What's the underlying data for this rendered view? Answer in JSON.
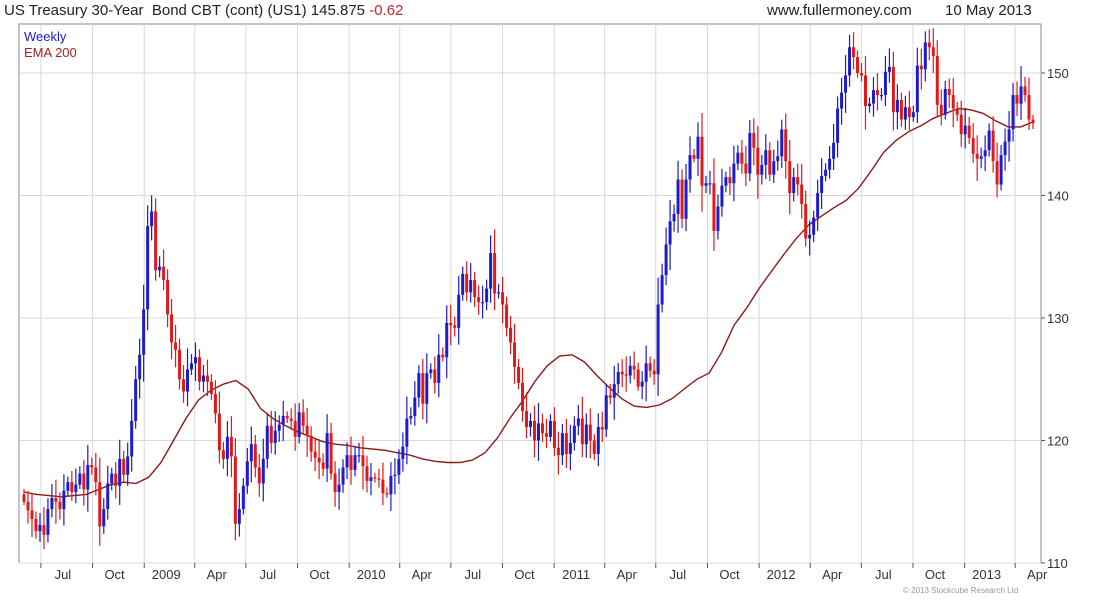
{
  "header": {
    "instrument": "US Treasury 30-Year  Bond CBT (cont) (US1)",
    "last": "145.875",
    "change": "-0.62",
    "site": "www.fullermoney.com",
    "date": "10 May 2013"
  },
  "legend": {
    "period": "Weekly",
    "overlay": "EMA 200"
  },
  "copyright": "© 2013 Stockcube Research Ltd",
  "colors": {
    "up": "#1c1cc8",
    "down": "#e01a1a",
    "ema": "#8b1a1a",
    "grid": "#d9d9d9",
    "axis": "#555555"
  },
  "chart_data": {
    "type": "candlestick",
    "period": "weekly",
    "ylim": [
      110,
      154
    ],
    "yticks": [
      110,
      120,
      130,
      140,
      150
    ],
    "xlim": [
      "2008-05-23",
      "2013-05-17"
    ],
    "xticks": [
      {
        "date": "2008-07-01",
        "label": "Jul"
      },
      {
        "date": "2008-10-01",
        "label": "Oct"
      },
      {
        "date": "2009-01-01",
        "label": "2009"
      },
      {
        "date": "2009-04-01",
        "label": "Apr"
      },
      {
        "date": "2009-07-01",
        "label": "Jul"
      },
      {
        "date": "2009-10-01",
        "label": "Oct"
      },
      {
        "date": "2010-01-01",
        "label": "2010"
      },
      {
        "date": "2010-04-01",
        "label": "Apr"
      },
      {
        "date": "2010-07-01",
        "label": "Jul"
      },
      {
        "date": "2010-10-01",
        "label": "Oct"
      },
      {
        "date": "2011-01-01",
        "label": "2011"
      },
      {
        "date": "2011-04-01",
        "label": "Apr"
      },
      {
        "date": "2011-07-01",
        "label": "Jul"
      },
      {
        "date": "2011-10-01",
        "label": "Oct"
      },
      {
        "date": "2012-01-01",
        "label": "2012"
      },
      {
        "date": "2012-04-01",
        "label": "Apr"
      },
      {
        "date": "2012-07-01",
        "label": "Jul"
      },
      {
        "date": "2012-10-01",
        "label": "Oct"
      },
      {
        "date": "2013-01-01",
        "label": "2013"
      },
      {
        "date": "2013-04-01",
        "label": "Apr"
      }
    ],
    "close": [
      115.0,
      114.3,
      113.6,
      112.6,
      113.1,
      112.3,
      114.4,
      115.3,
      115.0,
      114.4,
      115.9,
      116.6,
      115.8,
      116.4,
      117.3,
      116.0,
      118.0,
      117.8,
      116.6,
      113.0,
      114.4,
      116.5,
      117.3,
      116.3,
      118.5,
      117.2,
      118.7,
      121.6,
      125.0,
      127.0,
      130.7,
      137.5,
      138.7,
      133.9,
      134.2,
      133.1,
      130.3,
      128.0,
      127.4,
      125.0,
      124.0,
      125.8,
      126.3,
      126.8,
      124.8,
      125.3,
      124.8,
      123.8,
      122.2,
      119.2,
      118.5,
      120.3,
      118.7,
      113.2,
      114.4,
      116.3,
      118.3,
      119.7,
      117.8,
      116.5,
      118.5,
      121.2,
      119.8,
      120.8,
      121.3,
      122.0,
      121.8,
      121.6,
      120.3,
      122.3,
      121.2,
      120.4,
      119.1,
      118.6,
      118.2,
      117.7,
      120.6,
      117.3,
      115.8,
      116.4,
      117.8,
      118.8,
      117.6,
      118.8,
      118.8,
      117.9,
      116.7,
      117.0,
      116.9,
      116.8,
      115.7,
      115.6,
      117.1,
      117.2,
      118.5,
      119.5,
      121.8,
      122.0,
      123.5,
      125.5,
      123.0,
      125.5,
      125.8,
      124.7,
      127.0,
      126.8,
      129.6,
      129.4,
      129.2,
      131.9,
      133.6,
      132.1,
      133.1,
      131.7,
      131.3,
      131.3,
      132.4,
      135.3,
      132.0,
      132.1,
      131.1,
      129.2,
      128.0,
      126.0,
      124.7,
      122.4,
      121.1,
      121.6,
      120.0,
      121.4,
      120.6,
      120.3,
      121.6,
      119.4,
      118.8,
      120.6,
      118.9,
      119.8,
      121.2,
      121.8,
      119.7,
      121.3,
      120.0,
      118.9,
      121.1,
      120.9,
      123.7,
      123.5,
      124.6,
      125.6,
      125.4,
      125.3,
      126.1,
      125.8,
      124.4,
      124.8,
      126.3,
      125.7,
      125.4,
      131.1,
      133.5,
      136.0,
      137.9,
      138.5,
      141.3,
      138.1,
      141.3,
      143.3,
      143.0,
      144.8,
      140.8,
      141.0,
      141.0,
      137.1,
      139.1,
      140.8,
      141.5,
      141.0,
      142.6,
      143.5,
      142.6,
      141.8,
      145.1,
      143.9,
      141.7,
      142.5,
      143.7,
      141.7,
      142.8,
      143.2,
      145.4,
      142.8,
      140.2,
      141.5,
      140.9,
      139.3,
      136.5,
      136.8,
      138.2,
      140.2,
      141.6,
      142.1,
      143.0,
      144.3,
      147.1,
      148.4,
      149.8,
      152.1,
      151.3,
      150.0,
      149.8,
      147.3,
      147.5,
      148.6,
      148.2,
      148.2,
      150.1,
      150.5,
      146.8,
      147.8,
      146.2,
      147.2,
      146.4,
      146.8,
      150.6,
      150.3,
      152.5,
      152.1,
      151.4,
      147.4,
      146.6,
      148.7,
      148.2,
      147.1,
      146.6,
      145.0,
      145.7,
      144.7,
      143.4,
      143.0,
      143.2,
      143.7,
      145.3,
      142.8,
      140.9,
      143.3,
      144.4,
      145.4,
      148.2,
      147.5,
      148.9,
      148.2,
      146.2,
      145.9
    ],
    "ema200": [
      115.8,
      115.6,
      115.5,
      115.4,
      115.5,
      115.6,
      116.0,
      116.4,
      116.6,
      116.5,
      117.0,
      118.2,
      120.0,
      121.8,
      123.3,
      124.1,
      124.6,
      124.9,
      124.2,
      122.6,
      121.8,
      121.2,
      120.7,
      120.3,
      119.9,
      119.7,
      119.6,
      119.4,
      119.3,
      119.2,
      119.0,
      118.8,
      118.5,
      118.3,
      118.2,
      118.2,
      118.4,
      119.0,
      120.2,
      121.8,
      123.2,
      124.8,
      126.1,
      126.9,
      127.0,
      126.4,
      125.3,
      124.3,
      123.4,
      122.8,
      122.7,
      122.9,
      123.4,
      124.2,
      125.0,
      125.5,
      127.2,
      129.4,
      130.8,
      132.4,
      133.8,
      135.2,
      136.5,
      137.6,
      138.3,
      139.0,
      139.6,
      140.6,
      142.0,
      143.5,
      144.5,
      145.2,
      145.7,
      146.3,
      146.7,
      147.1,
      147.0,
      146.7,
      146.1,
      145.6,
      145.6,
      146.0
    ]
  }
}
